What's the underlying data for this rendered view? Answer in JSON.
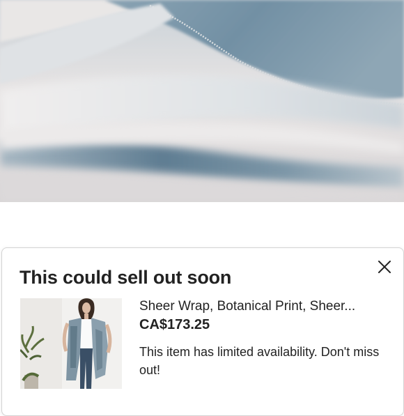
{
  "hero": {
    "image": "sheer-fabric-closeup",
    "colors": {
      "fabric": "#7d97a8",
      "highlight": "#e8e6e6",
      "shadow": "#4e6a80"
    }
  },
  "notice": {
    "title": "This could sell out soon",
    "close_icon": "close-icon"
  },
  "product": {
    "name": "Sheer Wrap, Botanical Print, Sheer...",
    "price": "CA$173.25",
    "availability_message": "This item has limited availability. Don't miss out!",
    "thumbnail": "model-wearing-wrap-photo"
  }
}
